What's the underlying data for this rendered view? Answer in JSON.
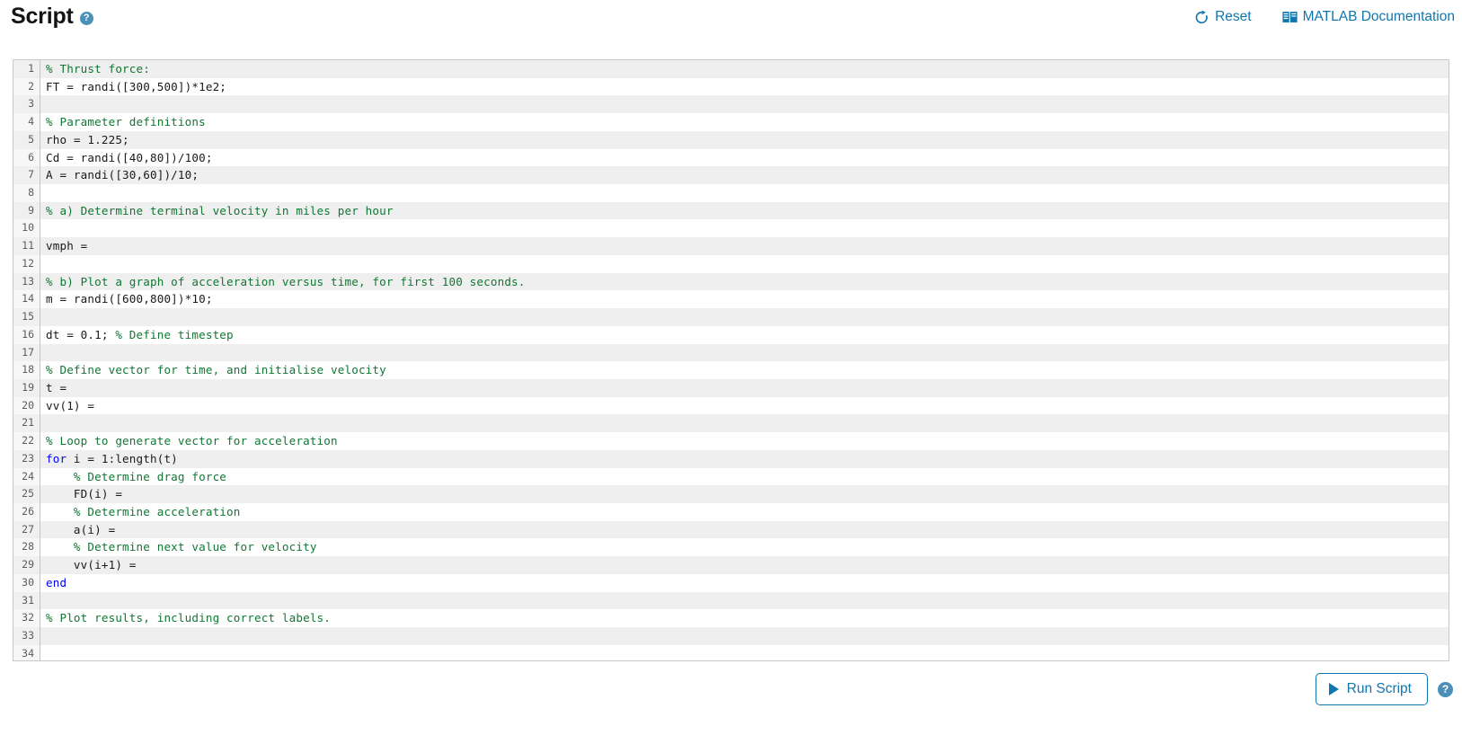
{
  "header": {
    "title": "Script",
    "help_icon": "help-circle-icon",
    "reset_label": "Reset",
    "reset_icon": "refresh-icon",
    "docs_label": "MATLAB Documentation",
    "docs_icon": "book-icon"
  },
  "editor": {
    "first_line": 1,
    "last_line": 34,
    "lines": [
      {
        "n": 1,
        "tokens": [
          {
            "t": "% Thrust force:",
            "c": "cmt"
          }
        ]
      },
      {
        "n": 2,
        "tokens": [
          {
            "t": "FT = randi([300,500])*1e2;",
            "c": "plain"
          }
        ]
      },
      {
        "n": 3,
        "tokens": []
      },
      {
        "n": 4,
        "tokens": [
          {
            "t": "% Parameter definitions",
            "c": "cmt"
          }
        ]
      },
      {
        "n": 5,
        "tokens": [
          {
            "t": "rho = 1.225;",
            "c": "plain"
          }
        ]
      },
      {
        "n": 6,
        "tokens": [
          {
            "t": "Cd = randi([40,80])/100;",
            "c": "plain"
          }
        ]
      },
      {
        "n": 7,
        "tokens": [
          {
            "t": "A = randi([30,60])/10;",
            "c": "plain"
          }
        ]
      },
      {
        "n": 8,
        "tokens": []
      },
      {
        "n": 9,
        "tokens": [
          {
            "t": "% a) Determine terminal velocity in miles per hour",
            "c": "cmt"
          }
        ]
      },
      {
        "n": 10,
        "tokens": []
      },
      {
        "n": 11,
        "tokens": [
          {
            "t": "vmph =",
            "c": "plain"
          }
        ]
      },
      {
        "n": 12,
        "tokens": []
      },
      {
        "n": 13,
        "tokens": [
          {
            "t": "% b) Plot a graph of acceleration versus time, for first 100 seconds.",
            "c": "cmt"
          }
        ]
      },
      {
        "n": 14,
        "tokens": [
          {
            "t": "m = randi([600,800])*10;",
            "c": "plain"
          }
        ]
      },
      {
        "n": 15,
        "tokens": []
      },
      {
        "n": 16,
        "tokens": [
          {
            "t": "dt = 0.1; ",
            "c": "plain"
          },
          {
            "t": "% Define timestep",
            "c": "cmt"
          }
        ]
      },
      {
        "n": 17,
        "tokens": []
      },
      {
        "n": 18,
        "tokens": [
          {
            "t": "% Define vector for time, and initialise velocity",
            "c": "cmt"
          }
        ]
      },
      {
        "n": 19,
        "tokens": [
          {
            "t": "t =",
            "c": "plain"
          }
        ]
      },
      {
        "n": 20,
        "tokens": [
          {
            "t": "vv(1) =",
            "c": "plain"
          }
        ]
      },
      {
        "n": 21,
        "tokens": []
      },
      {
        "n": 22,
        "tokens": [
          {
            "t": "% Loop to generate vector for acceleration",
            "c": "cmt"
          }
        ]
      },
      {
        "n": 23,
        "tokens": [
          {
            "t": "for",
            "c": "kw"
          },
          {
            "t": " i = 1:length(t)",
            "c": "plain"
          }
        ]
      },
      {
        "n": 24,
        "tokens": [
          {
            "t": "    % Determine drag force",
            "c": "cmt"
          }
        ]
      },
      {
        "n": 25,
        "tokens": [
          {
            "t": "    FD(i) =",
            "c": "plain"
          }
        ]
      },
      {
        "n": 26,
        "tokens": [
          {
            "t": "    % Determine acceleration",
            "c": "cmt"
          }
        ]
      },
      {
        "n": 27,
        "tokens": [
          {
            "t": "    a(i) =",
            "c": "plain"
          }
        ]
      },
      {
        "n": 28,
        "tokens": [
          {
            "t": "    % Determine next value for velocity",
            "c": "cmt"
          }
        ]
      },
      {
        "n": 29,
        "tokens": [
          {
            "t": "    vv(i+1) =",
            "c": "plain"
          }
        ]
      },
      {
        "n": 30,
        "tokens": [
          {
            "t": "end",
            "c": "kw"
          }
        ]
      },
      {
        "n": 31,
        "tokens": []
      },
      {
        "n": 32,
        "tokens": [
          {
            "t": "% Plot results, including correct labels.",
            "c": "cmt"
          }
        ]
      },
      {
        "n": 33,
        "tokens": []
      },
      {
        "n": 34,
        "tokens": []
      }
    ]
  },
  "footer": {
    "run_label": "Run Script",
    "run_icon": "play-icon",
    "help_icon": "help-circle-icon"
  },
  "colors": {
    "link": "#1076ad",
    "comment": "#117733",
    "keyword": "#0000ff",
    "code": "#1a1a1a",
    "row_alt": "#efefef",
    "help_badge": "#4a90b8"
  }
}
